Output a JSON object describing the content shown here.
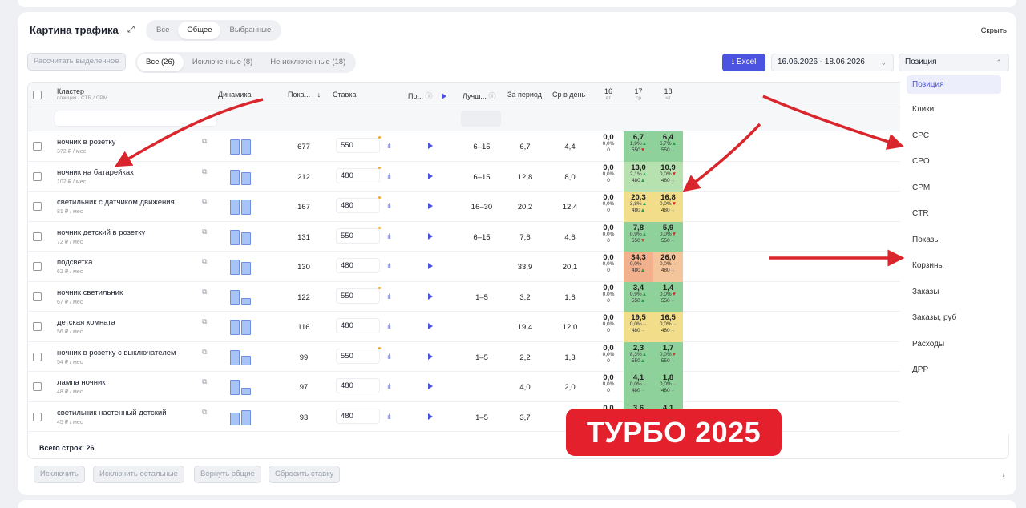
{
  "header": {
    "title": "Картина трафика",
    "hide_label": "Скрыть",
    "view_tabs": [
      "Все",
      "Общее",
      "Выбранные"
    ],
    "view_active": 1
  },
  "toolbar": {
    "calc_label": "Рассчитать выделенное",
    "filter_tabs": [
      "Все (26)",
      "Исключенные (8)",
      "Не исключенные (18)"
    ],
    "filter_active": 0,
    "excel_label": "Excel",
    "date_range": "16.06.2026 - 18.06.2026",
    "metric_value": "Позиция"
  },
  "dropdown": {
    "items": [
      "Позиция",
      "Клики",
      "CPC",
      "CPO",
      "CPM",
      "CTR",
      "Показы",
      "Корзины",
      "Заказы",
      "Заказы, руб",
      "Расходы",
      "ДРР"
    ],
    "selected": 0
  },
  "table": {
    "columns": {
      "cluster": "Кластер",
      "cluster_sub": "позиция / CTR / CPM",
      "dynamics": "Динамика",
      "shows": "Пока...",
      "bid": "Ставка",
      "pos": "По...",
      "best": "Лучш...",
      "period": "За период",
      "per_day": "Ср в день",
      "days": [
        {
          "d": "16",
          "w": "вт"
        },
        {
          "d": "17",
          "w": "ср"
        },
        {
          "d": "18",
          "w": "чт"
        }
      ]
    },
    "rows": [
      {
        "name": "ночник в розетку",
        "price": "372 ₽ / мес",
        "shows": "677",
        "bid": "550",
        "best": "6–15",
        "period": "6,7",
        "day": "4,4",
        "bars": [
          1,
          1
        ],
        "c16": [
          "0,0",
          "0,0%",
          "0"
        ],
        "c17": [
          "6,7",
          "1,9%",
          "550"
        ],
        "c18": [
          "6,4",
          "6,7%",
          "550"
        ],
        "a17": [
          "up",
          "dn"
        ],
        "a18": [
          "up",
          "fl"
        ],
        "h17": "green",
        "h18": "green",
        "dot": true
      },
      {
        "name": "ночник на батарейках",
        "price": "102 ₽ / мес",
        "shows": "212",
        "bid": "480",
        "best": "6–15",
        "period": "12,8",
        "day": "8,0",
        "bars": [
          1,
          0.85
        ],
        "c16": [
          "0,0",
          "0,0%",
          "0"
        ],
        "c17": [
          "13,0",
          "2,1%",
          "480"
        ],
        "c18": [
          "10,9",
          "0,0%",
          "480"
        ],
        "a17": [
          "up",
          "up"
        ],
        "a18": [
          "dn",
          "fl"
        ],
        "h17": "lgreen",
        "h18": "lgreen",
        "dot": true
      },
      {
        "name": "светильник с датчиком движения",
        "price": "81 ₽ / мес",
        "shows": "167",
        "bid": "480",
        "best": "16–30",
        "period": "20,2",
        "day": "12,4",
        "bars": [
          1,
          1
        ],
        "c16": [
          "0,0",
          "0,0%",
          "0"
        ],
        "c17": [
          "20,3",
          "3,8%",
          "480"
        ],
        "c18": [
          "16,8",
          "0,0%",
          "480"
        ],
        "a17": [
          "up",
          "up"
        ],
        "a18": [
          "dn",
          "fl"
        ],
        "h17": "yellow",
        "h18": "yellow",
        "dot": true
      },
      {
        "name": "ночник детский в розетку",
        "price": "72 ₽ / мес",
        "shows": "131",
        "bid": "550",
        "best": "6–15",
        "period": "7,6",
        "day": "4,6",
        "bars": [
          1,
          0.85
        ],
        "c16": [
          "0,0",
          "0,0%",
          "0"
        ],
        "c17": [
          "7,8",
          "0,9%",
          "550"
        ],
        "c18": [
          "5,9",
          "0,0%",
          "550"
        ],
        "a17": [
          "up",
          "dn"
        ],
        "a18": [
          "dn",
          "fl"
        ],
        "h17": "green",
        "h18": "green",
        "dot": true
      },
      {
        "name": "подсветка",
        "price": "62 ₽ / мес",
        "shows": "130",
        "bid": "480",
        "best": "",
        "period": "33,9",
        "day": "20,1",
        "bars": [
          1,
          0.85
        ],
        "c16": [
          "0,0",
          "0,0%",
          "0"
        ],
        "c17": [
          "34,3",
          "0,0%",
          "480"
        ],
        "c18": [
          "26,0",
          "0,0%",
          "480"
        ],
        "a17": [
          "fl",
          "up"
        ],
        "a18": [
          "fl",
          "fl"
        ],
        "h17": "salmon",
        "h18": "orange",
        "dot": false
      },
      {
        "name": "ночник светильник",
        "price": "67 ₽ / мес",
        "shows": "122",
        "bid": "550",
        "best": "1–5",
        "period": "3,2",
        "day": "1,6",
        "bars": [
          1,
          0.45
        ],
        "c16": [
          "0,0",
          "0,0%",
          "0"
        ],
        "c17": [
          "3,4",
          "0,9%",
          "550"
        ],
        "c18": [
          "1,4",
          "0,0%",
          "550"
        ],
        "a17": [
          "up",
          "up"
        ],
        "a18": [
          "dn",
          "fl"
        ],
        "h17": "green",
        "h18": "green",
        "dot": true
      },
      {
        "name": "детская комната",
        "price": "56 ₽ / мес",
        "shows": "116",
        "bid": "480",
        "best": "",
        "period": "19,4",
        "day": "12,0",
        "bars": [
          1,
          1
        ],
        "c16": [
          "0,0",
          "0,0%",
          "0"
        ],
        "c17": [
          "19,5",
          "0,0%",
          "480"
        ],
        "c18": [
          "16,5",
          "0,0%",
          "480"
        ],
        "a17": [
          "fl",
          "fl"
        ],
        "a18": [
          "fl",
          "fl"
        ],
        "h17": "yellow",
        "h18": "yellow",
        "dot": false
      },
      {
        "name": "ночник в розетку с выключателем",
        "price": "54 ₽ / мес",
        "shows": "99",
        "bid": "550",
        "best": "1–5",
        "period": "2,2",
        "day": "1,3",
        "bars": [
          1,
          0.65
        ],
        "c16": [
          "0,0",
          "0,0%",
          "0"
        ],
        "c17": [
          "2,3",
          "8,3%",
          "550"
        ],
        "c18": [
          "1,7",
          "0,0%",
          "550"
        ],
        "a17": [
          "up",
          "up"
        ],
        "a18": [
          "dn",
          "fl"
        ],
        "h17": "green",
        "h18": "green",
        "dot": true
      },
      {
        "name": "лампа ночник",
        "price": "48 ₽ / мес",
        "shows": "97",
        "bid": "480",
        "best": "",
        "period": "4,0",
        "day": "2,0",
        "bars": [
          1,
          0.45
        ],
        "c16": [
          "0,0",
          "0,0%",
          "0"
        ],
        "c17": [
          "4,1",
          "0,0%",
          "480"
        ],
        "c18": [
          "1,8",
          "0,0%",
          "480"
        ],
        "a17": [
          "fl",
          "fl"
        ],
        "a18": [
          "fl",
          "fl"
        ],
        "h17": "green",
        "h18": "green",
        "dot": false
      },
      {
        "name": "светильник настенный детский",
        "price": "45 ₽ / мес",
        "shows": "93",
        "bid": "480",
        "best": "1–5",
        "period": "3,7",
        "day": "",
        "bars": [
          0.85,
          1
        ],
        "c16": [
          "0,0",
          "0,0%",
          "0"
        ],
        "c17": [
          "3,6",
          "",
          ""
        ],
        "c18": [
          "4,1",
          "",
          ""
        ],
        "a17": [
          "fl",
          "fl"
        ],
        "a18": [
          "fl",
          "fl"
        ],
        "h17": "green",
        "h18": "green",
        "dot": false
      }
    ],
    "total": "Всего строк: 26"
  },
  "bottom": {
    "buttons": [
      "Исключить",
      "Исключить остальные",
      "Вернуть общие",
      "Сбросить ставку"
    ]
  },
  "overlay": {
    "badge": "ТУРБО 2025",
    "arrow_color": "#d9262c"
  }
}
